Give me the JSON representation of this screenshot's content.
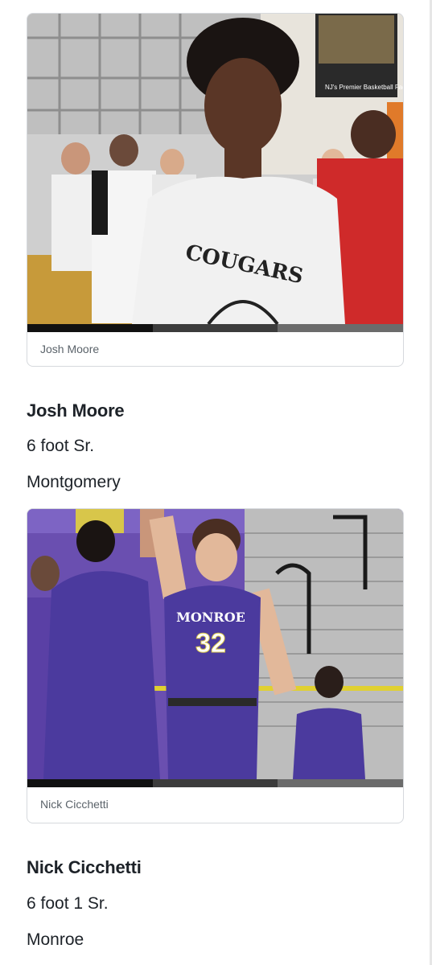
{
  "slides": [
    {
      "caption": "Josh Moore",
      "photo_alt": "Josh Moore",
      "banner_text": "NJ's Premier Basketball Facility",
      "jersey_text": "COUGARS"
    },
    {
      "caption": "Nick Cicchetti",
      "photo_alt": "Nick Cicchetti",
      "jersey_text": "MONROE",
      "jersey_number": "32"
    }
  ],
  "players": [
    {
      "name": "Josh Moore",
      "height_class": "6 foot Sr.",
      "school": "Montgomery"
    },
    {
      "name": "Nick Cicchetti",
      "height_class": "6 foot 1 Sr.",
      "school": "Monroe"
    }
  ],
  "colors": {
    "text": "#1d2228",
    "caption": "#5b636a",
    "border": "#d6d9dd",
    "monroe_purple": "#4b3a9e"
  }
}
